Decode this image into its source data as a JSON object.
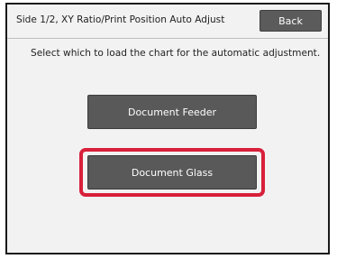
{
  "header": {
    "title": "Side 1/2, XY Ratio/Print Position Auto Adjust",
    "back_label": "Back"
  },
  "main": {
    "instruction": "Select which to load the chart for the automatic adjustment.",
    "options": [
      {
        "label": "Document Feeder"
      },
      {
        "label": "Document Glass",
        "highlighted": true
      }
    ]
  },
  "colors": {
    "button_bg": "#595959",
    "highlight": "#d8203a",
    "panel_bg": "#f2f2f2"
  }
}
